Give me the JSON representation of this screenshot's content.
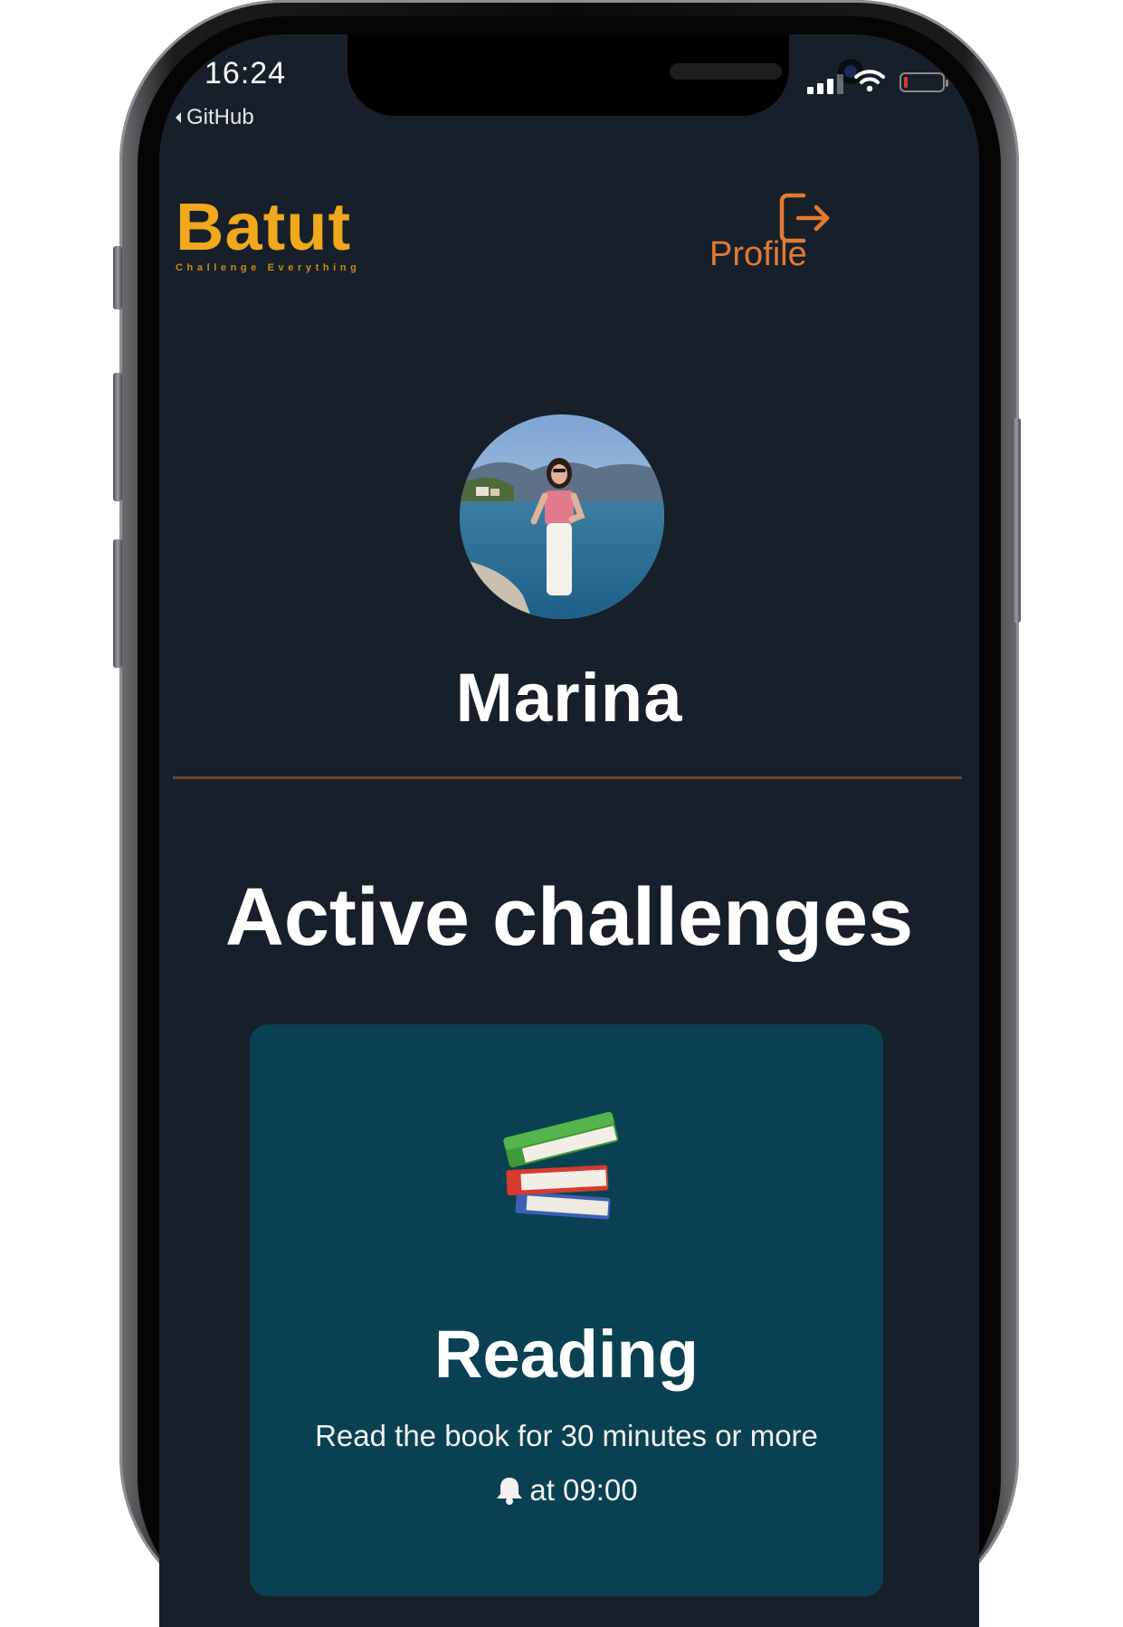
{
  "status_bar": {
    "time": "16:24",
    "back_app": "GitHub",
    "icons": [
      "cellular-signal-icon",
      "wifi-icon",
      "battery-icon"
    ],
    "battery_level": 0.08
  },
  "header": {
    "brand_name": "Batut",
    "brand_tagline": "Challenge Everything",
    "nav_profile": "Profile",
    "logout_icon": "logout-icon"
  },
  "profile": {
    "name": "Marina",
    "avatar": "avatar-photo"
  },
  "section": {
    "title": "Active challenges"
  },
  "challenges": [
    {
      "icon": "books-icon",
      "title": "Reading",
      "description": "Read the book for 30 minutes or more",
      "reminder_icon": "bell-icon",
      "reminder": "at 09:00"
    }
  ],
  "colors": {
    "background": "#17202a",
    "accent_orange": "#f0a81c",
    "nav_orange": "#e27a33",
    "divider": "#6b4536",
    "card": "#0a4152",
    "text": "#ffffff"
  }
}
